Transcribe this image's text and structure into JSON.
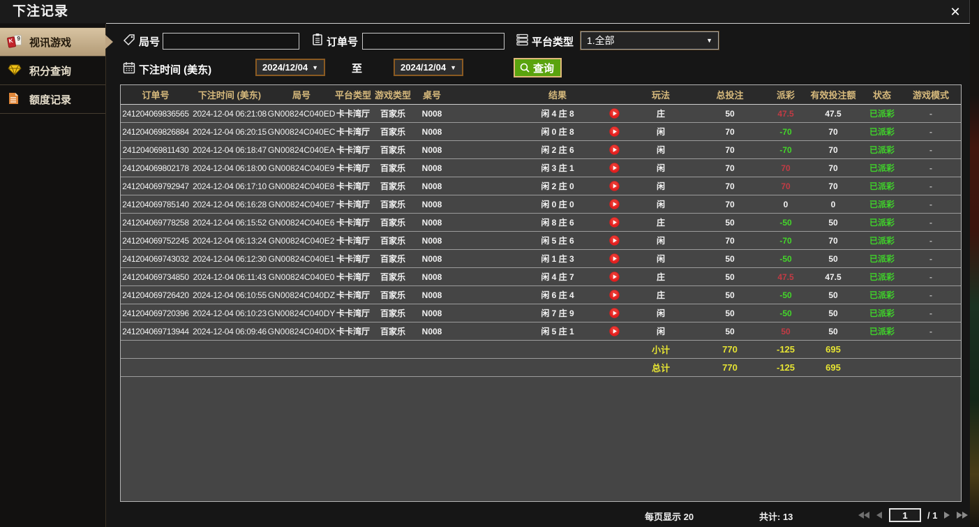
{
  "window": {
    "title": "下注记录",
    "close_label": "✕"
  },
  "sidebar": {
    "items": [
      {
        "label": "视讯游戏",
        "icon": "playing-cards-icon",
        "active": true
      },
      {
        "label": "积分查询",
        "icon": "gem-icon",
        "active": false
      },
      {
        "label": "额度记录",
        "icon": "document-icon",
        "active": false
      }
    ]
  },
  "filters": {
    "round_no": {
      "label": "局号",
      "value": "",
      "icon": "tag-icon"
    },
    "order_no": {
      "label": "订单号",
      "value": "",
      "icon": "clipboard-icon"
    },
    "platform_type": {
      "label": "平台类型",
      "value": "1.全部",
      "icon": "list-icon"
    },
    "bet_time": {
      "label": "下注时间 (美东)",
      "icon": "calendar-icon",
      "from": "2024/12/04",
      "to_label": "至",
      "to": "2024/12/04"
    },
    "search_button": {
      "label": "查询",
      "icon": "search-icon"
    }
  },
  "table": {
    "headers": [
      "订单号",
      "下注时间 (美东)",
      "局号",
      "平台类型",
      "游戏类型",
      "桌号",
      "",
      "结果",
      "",
      "玩法",
      "总投注",
      "派彩",
      "有效投注额",
      "状态",
      "游戏模式"
    ],
    "rows": [
      {
        "order_no": "241204069836565",
        "time": "2024-12-04 06:21:08",
        "round": "GN00824C040ED",
        "platform": "卡卡湾厅",
        "game": "百家乐",
        "table": "N008",
        "result": "闲 4 庄 8",
        "play": "庄",
        "bet": "50",
        "payout": "47.5",
        "payout_tone": "pos",
        "valid": "47.5",
        "status": "已派彩",
        "mode": "-"
      },
      {
        "order_no": "241204069826884",
        "time": "2024-12-04 06:20:15",
        "round": "GN00824C040EC",
        "platform": "卡卡湾厅",
        "game": "百家乐",
        "table": "N008",
        "result": "闲 0 庄 8",
        "play": "闲",
        "bet": "70",
        "payout": "-70",
        "payout_tone": "neg",
        "valid": "70",
        "status": "已派彩",
        "mode": "-"
      },
      {
        "order_no": "241204069811430",
        "time": "2024-12-04 06:18:47",
        "round": "GN00824C040EA",
        "platform": "卡卡湾厅",
        "game": "百家乐",
        "table": "N008",
        "result": "闲 2 庄 6",
        "play": "闲",
        "bet": "70",
        "payout": "-70",
        "payout_tone": "neg",
        "valid": "70",
        "status": "已派彩",
        "mode": "-"
      },
      {
        "order_no": "241204069802178",
        "time": "2024-12-04 06:18:00",
        "round": "GN00824C040E9",
        "platform": "卡卡湾厅",
        "game": "百家乐",
        "table": "N008",
        "result": "闲 3 庄 1",
        "play": "闲",
        "bet": "70",
        "payout": "70",
        "payout_tone": "pos",
        "valid": "70",
        "status": "已派彩",
        "mode": "-"
      },
      {
        "order_no": "241204069792947",
        "time": "2024-12-04 06:17:10",
        "round": "GN00824C040E8",
        "platform": "卡卡湾厅",
        "game": "百家乐",
        "table": "N008",
        "result": "闲 2 庄 0",
        "play": "闲",
        "bet": "70",
        "payout": "70",
        "payout_tone": "pos",
        "valid": "70",
        "status": "已派彩",
        "mode": "-"
      },
      {
        "order_no": "241204069785140",
        "time": "2024-12-04 06:16:28",
        "round": "GN00824C040E7",
        "platform": "卡卡湾厅",
        "game": "百家乐",
        "table": "N008",
        "result": "闲 0 庄 0",
        "play": "闲",
        "bet": "70",
        "payout": "0",
        "payout_tone": "zero",
        "valid": "0",
        "status": "已派彩",
        "mode": "-"
      },
      {
        "order_no": "241204069778258",
        "time": "2024-12-04 06:15:52",
        "round": "GN00824C040E6",
        "platform": "卡卡湾厅",
        "game": "百家乐",
        "table": "N008",
        "result": "闲 8 庄 6",
        "play": "庄",
        "bet": "50",
        "payout": "-50",
        "payout_tone": "neg",
        "valid": "50",
        "status": "已派彩",
        "mode": "-"
      },
      {
        "order_no": "241204069752245",
        "time": "2024-12-04 06:13:24",
        "round": "GN00824C040E2",
        "platform": "卡卡湾厅",
        "game": "百家乐",
        "table": "N008",
        "result": "闲 5 庄 6",
        "play": "闲",
        "bet": "70",
        "payout": "-70",
        "payout_tone": "neg",
        "valid": "70",
        "status": "已派彩",
        "mode": "-"
      },
      {
        "order_no": "241204069743032",
        "time": "2024-12-04 06:12:30",
        "round": "GN00824C040E1",
        "platform": "卡卡湾厅",
        "game": "百家乐",
        "table": "N008",
        "result": "闲 1 庄 3",
        "play": "闲",
        "bet": "50",
        "payout": "-50",
        "payout_tone": "neg",
        "valid": "50",
        "status": "已派彩",
        "mode": "-"
      },
      {
        "order_no": "241204069734850",
        "time": "2024-12-04 06:11:43",
        "round": "GN00824C040E0",
        "platform": "卡卡湾厅",
        "game": "百家乐",
        "table": "N008",
        "result": "闲 4 庄 7",
        "play": "庄",
        "bet": "50",
        "payout": "47.5",
        "payout_tone": "pos",
        "valid": "47.5",
        "status": "已派彩",
        "mode": "-"
      },
      {
        "order_no": "241204069726420",
        "time": "2024-12-04 06:10:55",
        "round": "GN00824C040DZ",
        "platform": "卡卡湾厅",
        "game": "百家乐",
        "table": "N008",
        "result": "闲 6 庄 4",
        "play": "庄",
        "bet": "50",
        "payout": "-50",
        "payout_tone": "neg",
        "valid": "50",
        "status": "已派彩",
        "mode": "-"
      },
      {
        "order_no": "241204069720396",
        "time": "2024-12-04 06:10:23",
        "round": "GN00824C040DY",
        "platform": "卡卡湾厅",
        "game": "百家乐",
        "table": "N008",
        "result": "闲 7 庄 9",
        "play": "闲",
        "bet": "50",
        "payout": "-50",
        "payout_tone": "neg",
        "valid": "50",
        "status": "已派彩",
        "mode": "-"
      },
      {
        "order_no": "241204069713944",
        "time": "2024-12-04 06:09:46",
        "round": "GN00824C040DX",
        "platform": "卡卡湾厅",
        "game": "百家乐",
        "table": "N008",
        "result": "闲 5 庄 1",
        "play": "闲",
        "bet": "50",
        "payout": "50",
        "payout_tone": "pos",
        "valid": "50",
        "status": "已派彩",
        "mode": "-"
      }
    ],
    "subtotal": {
      "label": "小计",
      "total_bet": "770",
      "payout": "-125",
      "valid_bet": "695"
    },
    "grand_total": {
      "label": "总计",
      "total_bet": "770",
      "payout": "-125",
      "valid_bet": "695"
    }
  },
  "pagination": {
    "per_page": "每页显示 20",
    "total_count": "共计: 13",
    "page": "1",
    "of": "/  1"
  },
  "colors": {
    "header_gold": "#d6b97c",
    "payout_win_red": "#c13b44",
    "payout_loss_green": "#43d62a",
    "status_green": "#3fd32a",
    "totals_yellow": "#e6e433",
    "search_button_green": "#5aa30e",
    "active_tab_tan": "#c8b28d",
    "play_icon_red": "#e31f1f"
  }
}
